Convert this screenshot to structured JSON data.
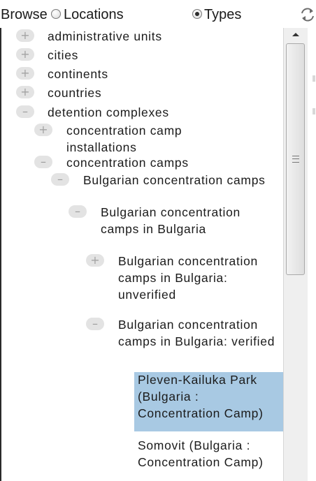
{
  "browse": {
    "label": "Browse",
    "option_locations": "Locations",
    "option_types": "Types",
    "selected": "Types"
  },
  "tree": [
    {
      "label": "administrative units",
      "state": "collapsed",
      "depth": 0
    },
    {
      "label": "cities",
      "state": "collapsed",
      "depth": 0
    },
    {
      "label": "continents",
      "state": "collapsed",
      "depth": 0
    },
    {
      "label": "countries",
      "state": "collapsed",
      "depth": 0
    },
    {
      "label": "detention complexes",
      "state": "expanded",
      "depth": 0
    },
    {
      "label": "concentration camp installations",
      "state": "collapsed",
      "depth": 1
    },
    {
      "label": "concentration camps",
      "state": "expanded",
      "depth": 1
    },
    {
      "label": "Bulgarian concentration camps",
      "state": "expanded",
      "depth": 2
    },
    {
      "label": "Bulgarian concentration camps in Bulgaria",
      "state": "expanded",
      "depth": 3
    },
    {
      "label": "Bulgarian concentration camps in Bulgaria: unverified",
      "state": "collapsed",
      "depth": 4
    },
    {
      "label": "Bulgarian concentration camps in Bulgaria: verified",
      "state": "expanded",
      "depth": 4
    },
    {
      "label": "Pleven-Kailuka Park (Bulgaria : Concentration Camp)",
      "state": "leaf",
      "depth": 5,
      "selected": true
    },
    {
      "label": "Somovit (Bulgaria : Concentration Camp)",
      "state": "leaf",
      "depth": 5
    }
  ],
  "icons": {
    "refresh": "refresh-icon",
    "expand": "plus-icon",
    "collapse": "minus-icon"
  },
  "colors": {
    "selection": "#a8c9e3",
    "expander": "#e3e3e3"
  }
}
